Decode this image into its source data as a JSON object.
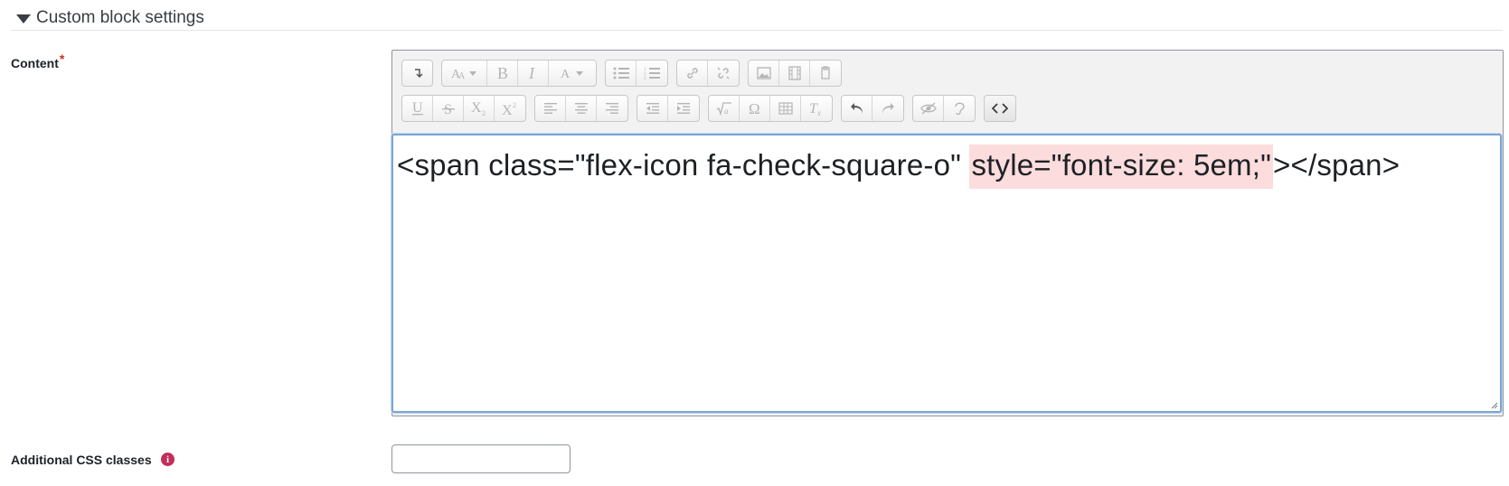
{
  "section": {
    "title": "Custom block settings"
  },
  "content_field": {
    "label": "Content",
    "required_mark": "*"
  },
  "editor": {
    "code_before": "<span class=\"flex-icon fa-check-square-o\" ",
    "code_highlight": "style=\"font-size: 5em;\"",
    "code_after": "></span>"
  },
  "css_field": {
    "label": "Additional CSS classes",
    "value": "",
    "info_icon": "i"
  },
  "icons": {
    "row1": [
      "arrow-icon",
      "paragraph-style-icon",
      "bold-icon",
      "italic-icon",
      "font-color-icon",
      "unordered-list-icon",
      "ordered-list-icon",
      "link-icon",
      "unlink-icon",
      "image-icon",
      "media-icon",
      "manage-files-icon"
    ],
    "row2": [
      "underline-icon",
      "strikethrough-icon",
      "subscript-icon",
      "superscript-icon",
      "align-left-icon",
      "align-center-icon",
      "align-right-icon",
      "outdent-icon",
      "indent-icon",
      "equation-icon",
      "special-character-icon",
      "table-icon",
      "clear-formatting-icon",
      "undo-icon",
      "redo-icon",
      "accessibility-checker-icon",
      "screenreader-helper-icon",
      "html-source-icon"
    ]
  }
}
